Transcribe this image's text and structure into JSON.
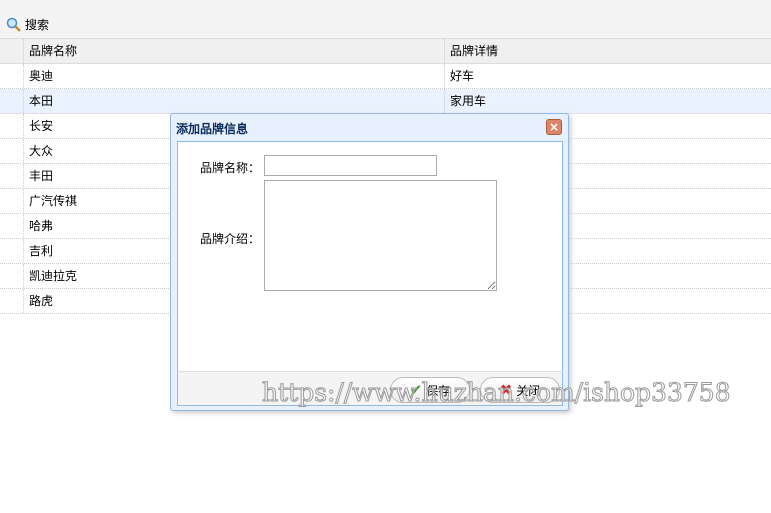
{
  "toolbar": {
    "search_label": "搜索"
  },
  "grid": {
    "headers": [
      "品牌名称",
      "品牌详情"
    ],
    "rows": [
      [
        "奥迪",
        "好车"
      ],
      [
        "本田",
        "家用车"
      ],
      [
        "长安",
        ""
      ],
      [
        "大众",
        ""
      ],
      [
        "丰田",
        ""
      ],
      [
        "广汽传祺",
        ""
      ],
      [
        "哈弗",
        ""
      ],
      [
        "吉利",
        ""
      ],
      [
        "凯迪拉克",
        ""
      ],
      [
        "路虎",
        ""
      ]
    ]
  },
  "dialog": {
    "title": "添加品牌信息",
    "name_label": "品牌名称：",
    "name_value": "",
    "intro_label": "品牌介绍：",
    "intro_value": "",
    "save_label": "保存",
    "close_label": "关闭"
  },
  "watermark": "https://www.huzhan.com/ishop33758"
}
